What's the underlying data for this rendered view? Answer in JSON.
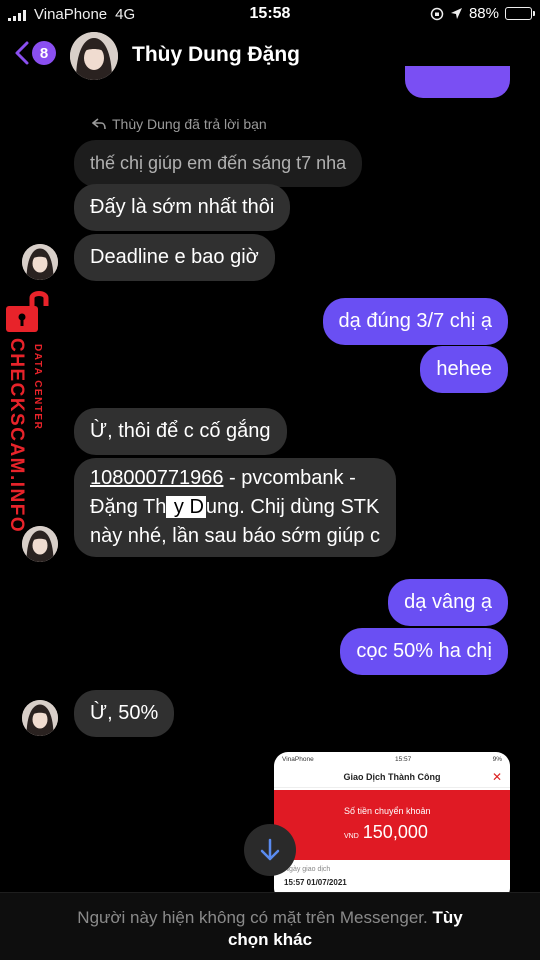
{
  "status_bar": {
    "carrier": "VinaPhone",
    "network": "4G",
    "time": "15:58",
    "battery": "88%",
    "battery_level": 0.88
  },
  "header": {
    "unread_count": "8",
    "contact_name": "Thùy Dung Đặng"
  },
  "reply_note": "Thùy Dung đã trả lời bạn",
  "messages": {
    "quoted": "thế chị giúp em đến sáng t7 nha",
    "m1": "Đấy là sớm nhất thôi",
    "m2": "Deadline e bao giờ",
    "m3": "dạ đúng 3/7 chị ạ",
    "m4": "hehee",
    "m5": "Ừ, thôi để c cố gắng",
    "m6_account": "108000771966",
    "m6_rest1": " - pvcombank -",
    "m6_line2_a": "Đặng Th",
    "m6_line2_hl": " y D",
    "m6_line2_b": "ung. Chij dùng STK",
    "m6_line3": "này nhé, lần sau báo sớm giúp c",
    "m7": "dạ vâng ạ",
    "m8": "cọc 50% ha chị",
    "m9": "Ừ, 50%"
  },
  "watermark": {
    "main": "CHECKSCAM.INFO",
    "sub": "DATA CENTER"
  },
  "thumbnail": {
    "carrier": "VinaPhone",
    "time": "15:57",
    "battery": "9%",
    "title": "Giao Dịch Thành Công",
    "amount_label": "Số tiền chuyển khoản",
    "currency": "VND",
    "amount": "150,000",
    "date_label": "Ngày giao dịch",
    "date": "15:57 01/07/2021"
  },
  "footer": {
    "notice": "Người này hiện không có mặt trên Messenger.",
    "link_part1": "Tùy",
    "link_part2": "chọn khác"
  },
  "colors": {
    "outgoing": "#6a4ff3",
    "incoming": "#303030",
    "accent": "#8a4ff0",
    "watermark": "#e8232a"
  }
}
